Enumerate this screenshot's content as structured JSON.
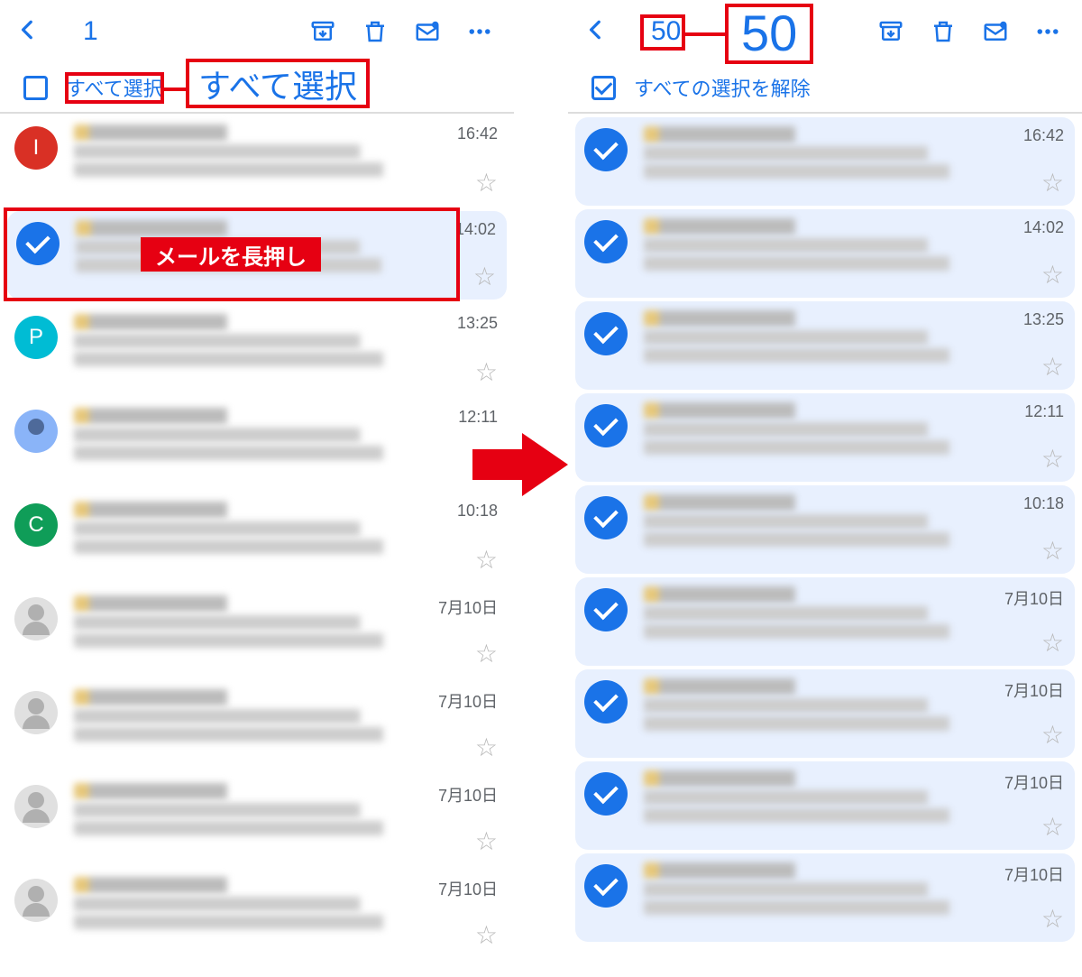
{
  "left": {
    "count": "1",
    "select_all_label": "すべて選択",
    "callout_select_all": "すべて選択",
    "callout_longpress": "メールを長押し",
    "items": [
      {
        "avatar_letter": "I",
        "avatar_bg": "#d93025",
        "time": "16:42",
        "selected": false,
        "starred_label": "スター"
      },
      {
        "avatar_letter": "",
        "avatar_bg": "",
        "time": "14:02",
        "selected": true
      },
      {
        "avatar_letter": "P",
        "avatar_bg": "#00bcd4",
        "time": "13:25",
        "selected": false
      },
      {
        "avatar_letter": "",
        "avatar_bg": "#8ab4f8",
        "time": "12:11",
        "selected": false,
        "gray_style": "contact"
      },
      {
        "avatar_letter": "C",
        "avatar_bg": "#0f9d58",
        "time": "10:18",
        "selected": false
      },
      {
        "avatar_letter": "",
        "avatar_bg": "",
        "time": "7月10日",
        "selected": false,
        "gray": true
      },
      {
        "avatar_letter": "",
        "avatar_bg": "",
        "time": "7月10日",
        "selected": false,
        "gray": true
      },
      {
        "avatar_letter": "",
        "avatar_bg": "",
        "time": "7月10日",
        "selected": false,
        "gray": true
      },
      {
        "avatar_letter": "",
        "avatar_bg": "",
        "time": "7月10日",
        "selected": false,
        "gray": true
      }
    ]
  },
  "right": {
    "count": "50",
    "big_count": "50",
    "deselect_label": "すべての選択を解除",
    "items": [
      {
        "time": "16:42"
      },
      {
        "time": "14:02"
      },
      {
        "time": "13:25"
      },
      {
        "time": "12:11"
      },
      {
        "time": "10:18"
      },
      {
        "time": "7月10日"
      },
      {
        "time": "7月10日"
      },
      {
        "time": "7月10日"
      },
      {
        "time": "7月10日"
      }
    ]
  },
  "icons": {
    "archive": "archive-icon",
    "trash": "trash-icon",
    "mark": "mark-unread-icon",
    "more": "more-icon"
  }
}
